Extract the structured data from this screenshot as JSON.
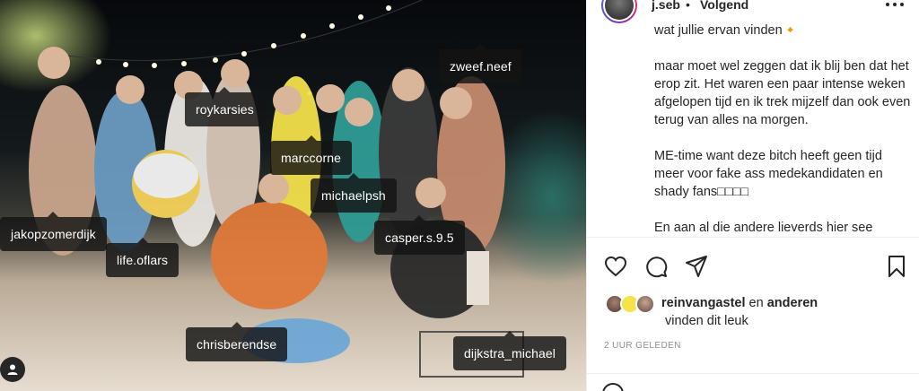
{
  "post": {
    "photo_alt": "Groepsfoto",
    "tags": [
      {
        "id": "roykarsies",
        "label": "roykarsies"
      },
      {
        "id": "zweef",
        "label": "zweef.neef"
      },
      {
        "id": "marccorne",
        "label": "marccorne"
      },
      {
        "id": "michaelpsh",
        "label": "michaelpsh"
      },
      {
        "id": "jakop",
        "label": "jakopzomerdijk"
      },
      {
        "id": "casper",
        "label": "casper.s.9.5"
      },
      {
        "id": "lifeoflars",
        "label": "life.oflars"
      },
      {
        "id": "chris",
        "label": "chrisberendse"
      },
      {
        "id": "dijkstra",
        "label": "dijkstra_michael"
      }
    ],
    "user_tag_icon": "person-icon"
  },
  "header": {
    "username": "j.seb",
    "separator": "•",
    "follow_label": "Volgend",
    "more_icon": "more-dots-icon"
  },
  "caption": {
    "line_top": "wat jullie ervan vinden🔸",
    "p1": "maar moet wel zeggen dat ik blij ben dat het erop zit. Het waren een paar intense weken afgelopen tijd en ik trek mijzelf dan ook even terug van alles na morgen.",
    "p2": "ME-time want deze bitch heeft geen tijd meer voor fake ass medekandidaten en shady fans□□□□",
    "p3": "En aan al die andere lieverds hier see"
  },
  "actions": {
    "like_icon": "heart-icon",
    "comment_icon": "comment-icon",
    "share_icon": "send-icon",
    "save_icon": "bookmark-icon"
  },
  "likes": {
    "first_user": "reinvangastel",
    "connector": "en",
    "others": "anderen",
    "line2": "vinden dit leuk"
  },
  "timestamp": "2 UUR GELEDEN",
  "colors": {
    "text": "#262626",
    "muted": "#8e8e8e",
    "tag_bg": "#141414"
  }
}
